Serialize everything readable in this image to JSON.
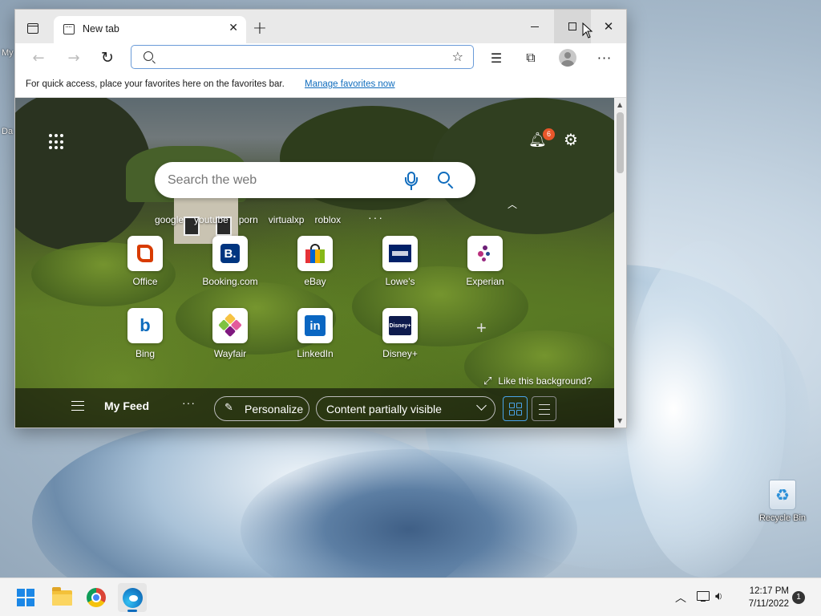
{
  "desktop": {
    "peek_labels": [
      "My",
      "Da"
    ],
    "recycle_bin_label": "Recycle Bin"
  },
  "browser": {
    "tab": {
      "title": "New tab"
    },
    "address": {
      "value": "",
      "placeholder": ""
    },
    "favorites_bar": {
      "message": "For quick access, place your favorites here on the favorites bar.",
      "link": "Manage favorites now"
    }
  },
  "ntp": {
    "notification_count": "6",
    "search": {
      "placeholder": "Search the web"
    },
    "trending": [
      "google",
      "youtube",
      "porn",
      "virtualxp",
      "roblox"
    ],
    "more_glyph": "…",
    "tiles_row1": [
      "Office",
      "Booking.com",
      "eBay",
      "Lowe's",
      "Experian"
    ],
    "tiles_row2": [
      "Bing",
      "Wayfair",
      "LinkedIn",
      "Disney+"
    ],
    "tile_glyphs": {
      "booking": "B.",
      "bing": "b",
      "linkedin": "in",
      "disney": "Disney+"
    },
    "like_background": "Like this background?",
    "feed": {
      "my_feed": "My Feed",
      "personalize": "Personalize",
      "content_visibility": "Content partially visible"
    }
  },
  "taskbar": {
    "time": "12:17 PM",
    "date": "7/11/2022",
    "notification_count": "1"
  },
  "colors": {
    "accent": "#0f6cbd",
    "start": "#1b87e6",
    "badge": "#e8562a"
  }
}
